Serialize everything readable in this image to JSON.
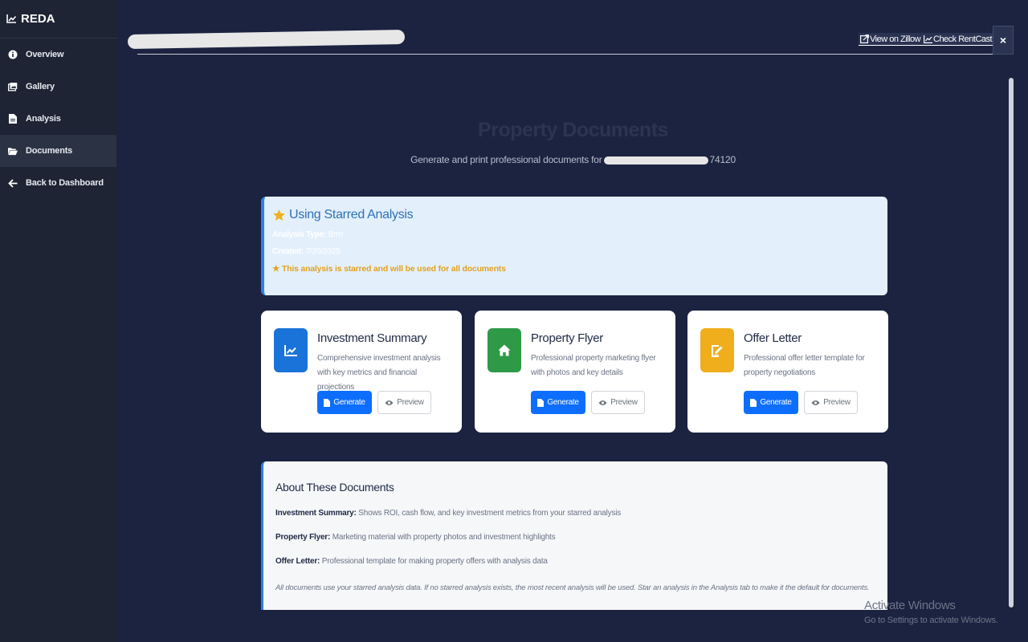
{
  "app": {
    "name": "REDA"
  },
  "sidebar": {
    "items": [
      {
        "label": "Overview",
        "icon": "info-icon"
      },
      {
        "label": "Gallery",
        "icon": "image-icon"
      },
      {
        "label": "Analysis",
        "icon": "document-icon"
      },
      {
        "label": "Documents",
        "icon": "folder-open-icon",
        "active": true
      },
      {
        "label": "Back to Dashboard",
        "icon": "arrow-left-icon"
      }
    ]
  },
  "header": {
    "zillow_label": "View on Zillow",
    "rentcast_label": "Check RentCast",
    "close_label": "×"
  },
  "page": {
    "title": "Property Documents",
    "subtitle_prefix": "Generate and print professional documents for",
    "subtitle_suffix": "74120"
  },
  "starred": {
    "heading": "Using Starred Analysis",
    "type_label": "Analysis Type:",
    "type_value": "Brrrr",
    "created_label": "Created:",
    "created_value": "7/20/2025",
    "note": "★ This analysis is starred and will be used for all documents"
  },
  "cards": [
    {
      "title": "Investment Summary",
      "desc": "Comprehensive investment analysis with key metrics and financial projections",
      "icon": "chart-line-icon",
      "color": "#1a73d9",
      "generate": "Generate",
      "preview": "Preview"
    },
    {
      "title": "Property Flyer",
      "desc": "Professional property marketing flyer with photos and key details",
      "icon": "home-icon",
      "color": "#2e9a47",
      "generate": "Generate",
      "preview": "Preview"
    },
    {
      "title": "Offer Letter",
      "desc": "Professional offer letter template for property negotiations",
      "icon": "signature-icon",
      "color": "#f0ad1c",
      "generate": "Generate",
      "preview": "Preview"
    }
  ],
  "about": {
    "title": "About These Documents",
    "rows": [
      {
        "label": "Investment Summary:",
        "text": "Shows ROI, cash flow, and key investment metrics from your starred analysis"
      },
      {
        "label": "Property Flyer:",
        "text": "Marketing material with property photos and investment highlights"
      },
      {
        "label": "Offer Letter:",
        "text": "Professional template for making property offers with analysis data"
      }
    ],
    "footnote": "All documents use your starred analysis data. If no starred analysis exists, the most recent analysis will be used. Star an analysis in the Analysis tab to make it the default for documents."
  },
  "watermark": {
    "line1": "Activate Windows",
    "line2": "Go to Settings to activate Windows."
  }
}
